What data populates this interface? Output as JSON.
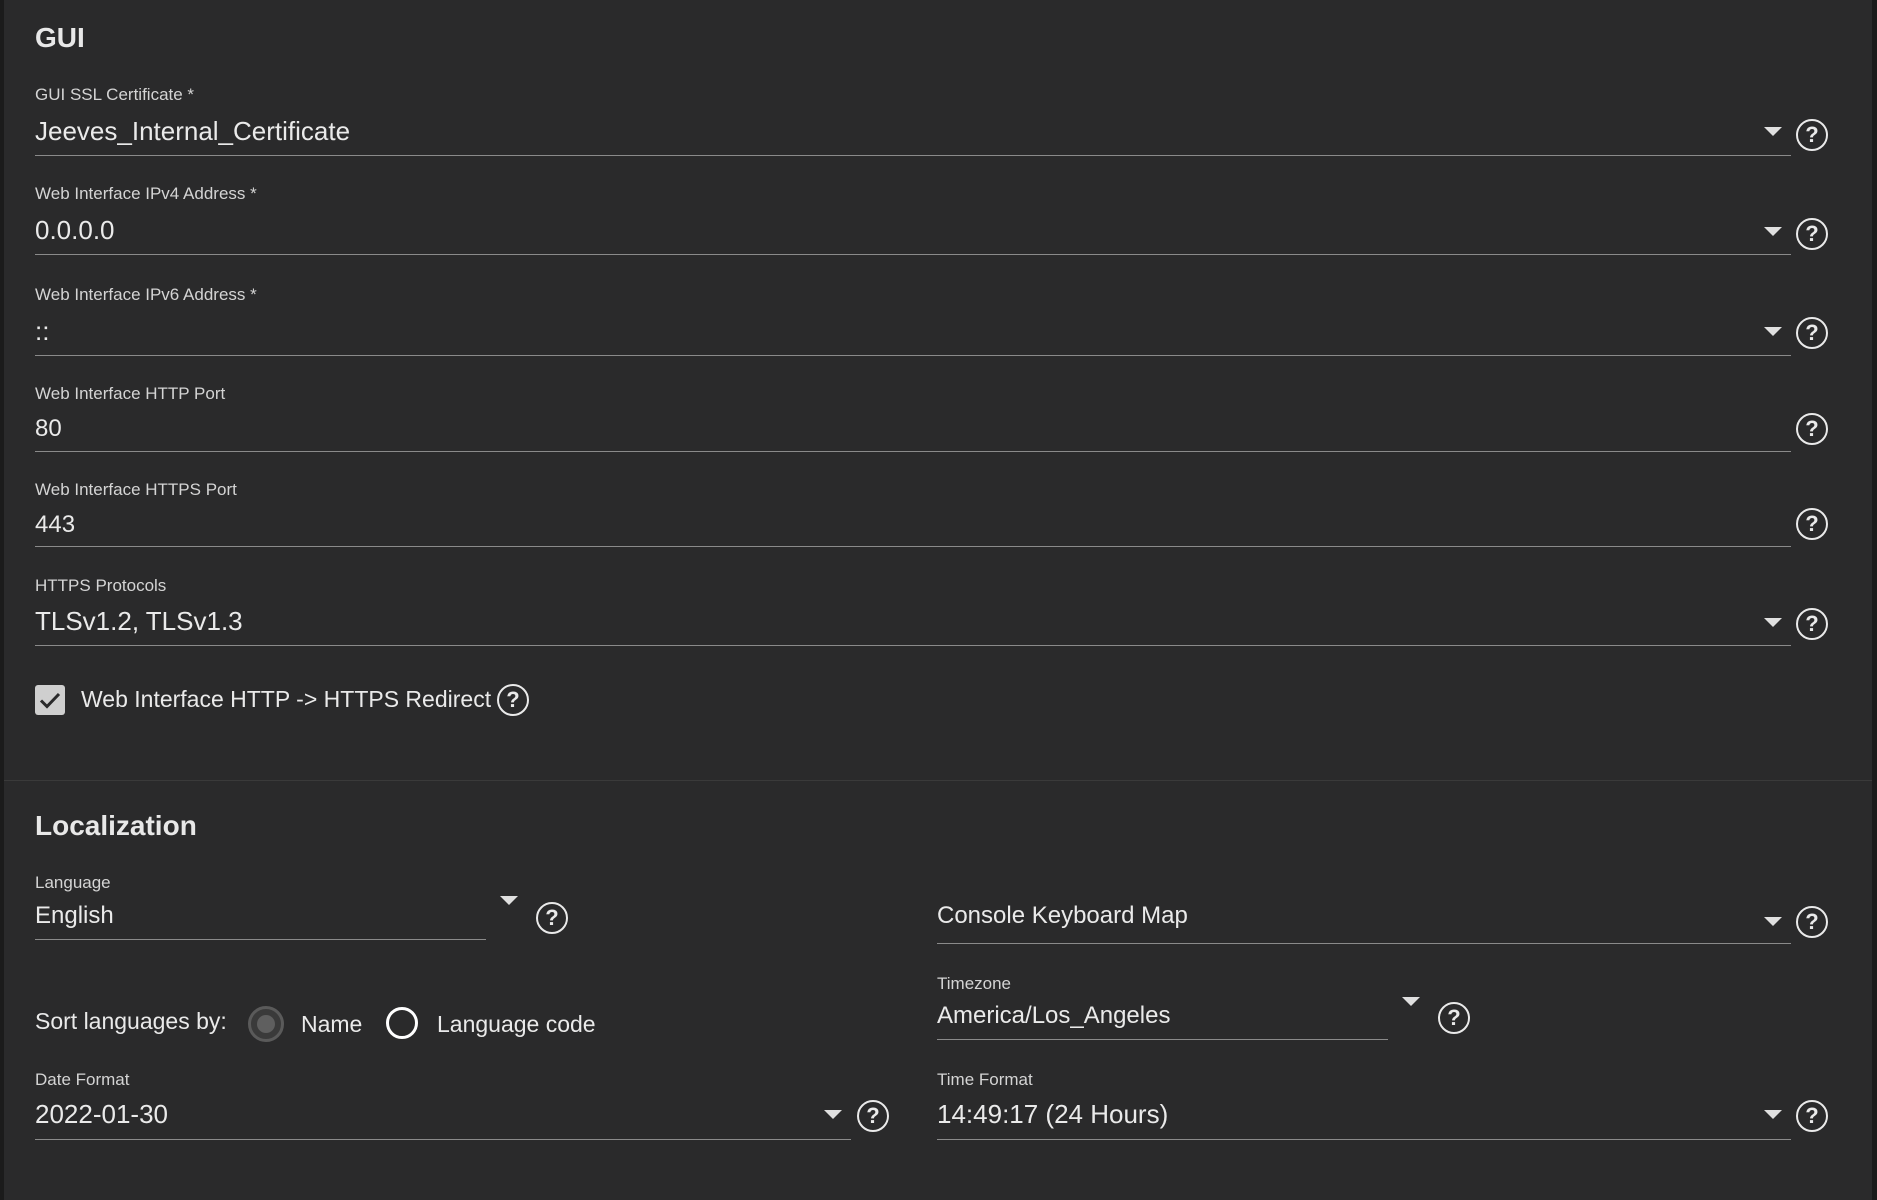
{
  "gui": {
    "title": "GUI",
    "ssl_cert": {
      "label": "GUI SSL Certificate *",
      "value": "Jeeves_Internal_Certificate"
    },
    "ipv4": {
      "label": "Web Interface IPv4 Address *",
      "value": "0.0.0.0"
    },
    "ipv6": {
      "label": "Web Interface IPv6 Address *",
      "value": "::"
    },
    "http_port": {
      "label": "Web Interface HTTP Port",
      "value": "80"
    },
    "https_port": {
      "label": "Web Interface HTTPS Port",
      "value": "443"
    },
    "https_protocols": {
      "label": "HTTPS Protocols",
      "value": "TLSv1.2, TLSv1.3"
    },
    "redirect": {
      "label": "Web Interface HTTP -> HTTPS Redirect",
      "checked": true
    }
  },
  "localization": {
    "title": "Localization",
    "language": {
      "label": "Language",
      "value": "English"
    },
    "console_keyboard_map": {
      "placeholder": "Console Keyboard Map"
    },
    "sort_languages": {
      "label": "Sort languages by:",
      "options": [
        "Name",
        "Language code"
      ],
      "selected": "Name"
    },
    "timezone": {
      "label": "Timezone",
      "value": "America/Los_Angeles"
    },
    "date_format": {
      "label": "Date Format",
      "value": "2022-01-30"
    },
    "time_format": {
      "label": "Time Format",
      "value": "14:49:17 (24 Hours)"
    }
  },
  "icons": {
    "help": "help-circle-icon",
    "dropdown": "caret-down-icon",
    "check": "check-icon"
  }
}
